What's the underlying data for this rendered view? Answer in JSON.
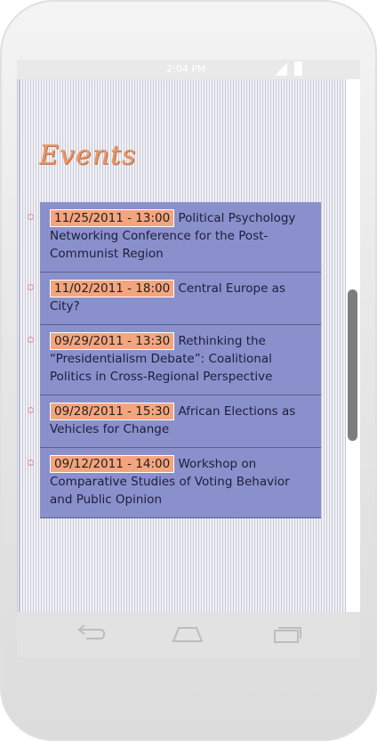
{
  "status_bar": {
    "time": "2:04 PM"
  },
  "page": {
    "title": "Events"
  },
  "events": [
    {
      "date": "11/25/2011 - 13:00",
      "title": "Political Psychology Networking Conference for the Post-Communist Region"
    },
    {
      "date": "11/02/2011 - 18:00",
      "title": "Central Europe as City?"
    },
    {
      "date": "09/29/2011 - 13:30",
      "title": "Rethinking the “Presidentialism Debate”: Coalitional Politics in Cross-Regional Perspective"
    },
    {
      "date": "09/28/2011 - 15:30",
      "title": "African Elections as Vehicles for Change"
    },
    {
      "date": "09/12/2011 - 14:00",
      "title": "Workshop on Comparative Studies of Voting Behavior and Public Opinion"
    }
  ],
  "nav_bar": {
    "icons": [
      "back-icon",
      "home-icon",
      "recents-icon"
    ]
  },
  "colors": {
    "accent": "#e8956a",
    "list_bg": "#8a90cc",
    "date_bg": "#f4a57e"
  }
}
